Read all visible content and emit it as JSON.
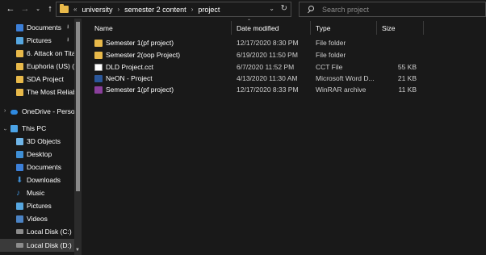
{
  "nav": {
    "back_icon": "arrow-left",
    "forward_icon": "arrow-right",
    "recent_icon": "chevron-down",
    "up_icon": "arrow-up"
  },
  "address": {
    "lead": "«",
    "crumbs": [
      "university",
      "semester 2 content",
      "project"
    ],
    "dropdown_icon": "chevron-down",
    "refresh_icon": "refresh"
  },
  "search": {
    "placeholder": "Search project"
  },
  "sidebar": {
    "items": [
      {
        "label": "Documents",
        "icon": "documents-icon",
        "pinned": true
      },
      {
        "label": "Pictures",
        "icon": "pictures-icon",
        "pinned": true
      },
      {
        "label": "6. Attack on Tita",
        "icon": "folder-icon"
      },
      {
        "label": "Euphoria (US) (2",
        "icon": "folder-icon"
      },
      {
        "label": "SDA Project",
        "icon": "folder-icon"
      },
      {
        "label": "The Most Reliabl",
        "icon": "folder-icon"
      },
      {
        "label": "OneDrive - Persor",
        "icon": "onedrive-icon"
      },
      {
        "label": "This PC",
        "icon": "pc-icon"
      },
      {
        "label": "3D Objects",
        "icon": "3d-objects-icon"
      },
      {
        "label": "Desktop",
        "icon": "desktop-icon"
      },
      {
        "label": "Documents",
        "icon": "documents-icon"
      },
      {
        "label": "Downloads",
        "icon": "downloads-icon"
      },
      {
        "label": "Music",
        "icon": "music-icon"
      },
      {
        "label": "Pictures",
        "icon": "pictures-icon"
      },
      {
        "label": "Videos",
        "icon": "videos-icon"
      },
      {
        "label": "Local Disk (C:)",
        "icon": "disk-icon"
      },
      {
        "label": "Local Disk (D:)",
        "icon": "disk-icon",
        "selected": true
      }
    ]
  },
  "columns": {
    "name": "Name",
    "date": "Date modified",
    "type": "Type",
    "size": "Size"
  },
  "files": [
    {
      "name": "Semester 1(pf project)",
      "date": "12/17/2020 8:30 PM",
      "type": "File folder",
      "size": "",
      "icon": "folder-icon"
    },
    {
      "name": "Semester 2(oop Project)",
      "date": "6/19/2020 11:50 PM",
      "type": "File folder",
      "size": "",
      "icon": "folder-icon"
    },
    {
      "name": "DLD Project.cct",
      "date": "6/7/2020 11:52 PM",
      "type": "CCT File",
      "size": "55 KB",
      "icon": "file-icon"
    },
    {
      "name": "NeON - Project",
      "date": "4/13/2020 11:30 AM",
      "type": "Microsoft Word D...",
      "size": "21 KB",
      "icon": "word-icon"
    },
    {
      "name": "Semester 1(pf project)",
      "date": "12/17/2020 8:33 PM",
      "type": "WinRAR archive",
      "size": "11 KB",
      "icon": "winrar-icon"
    }
  ],
  "colors": {
    "background": "#191919",
    "folder": "#e8b94a",
    "selection": "#3a3a3a",
    "accent": "#3c7fd8"
  }
}
